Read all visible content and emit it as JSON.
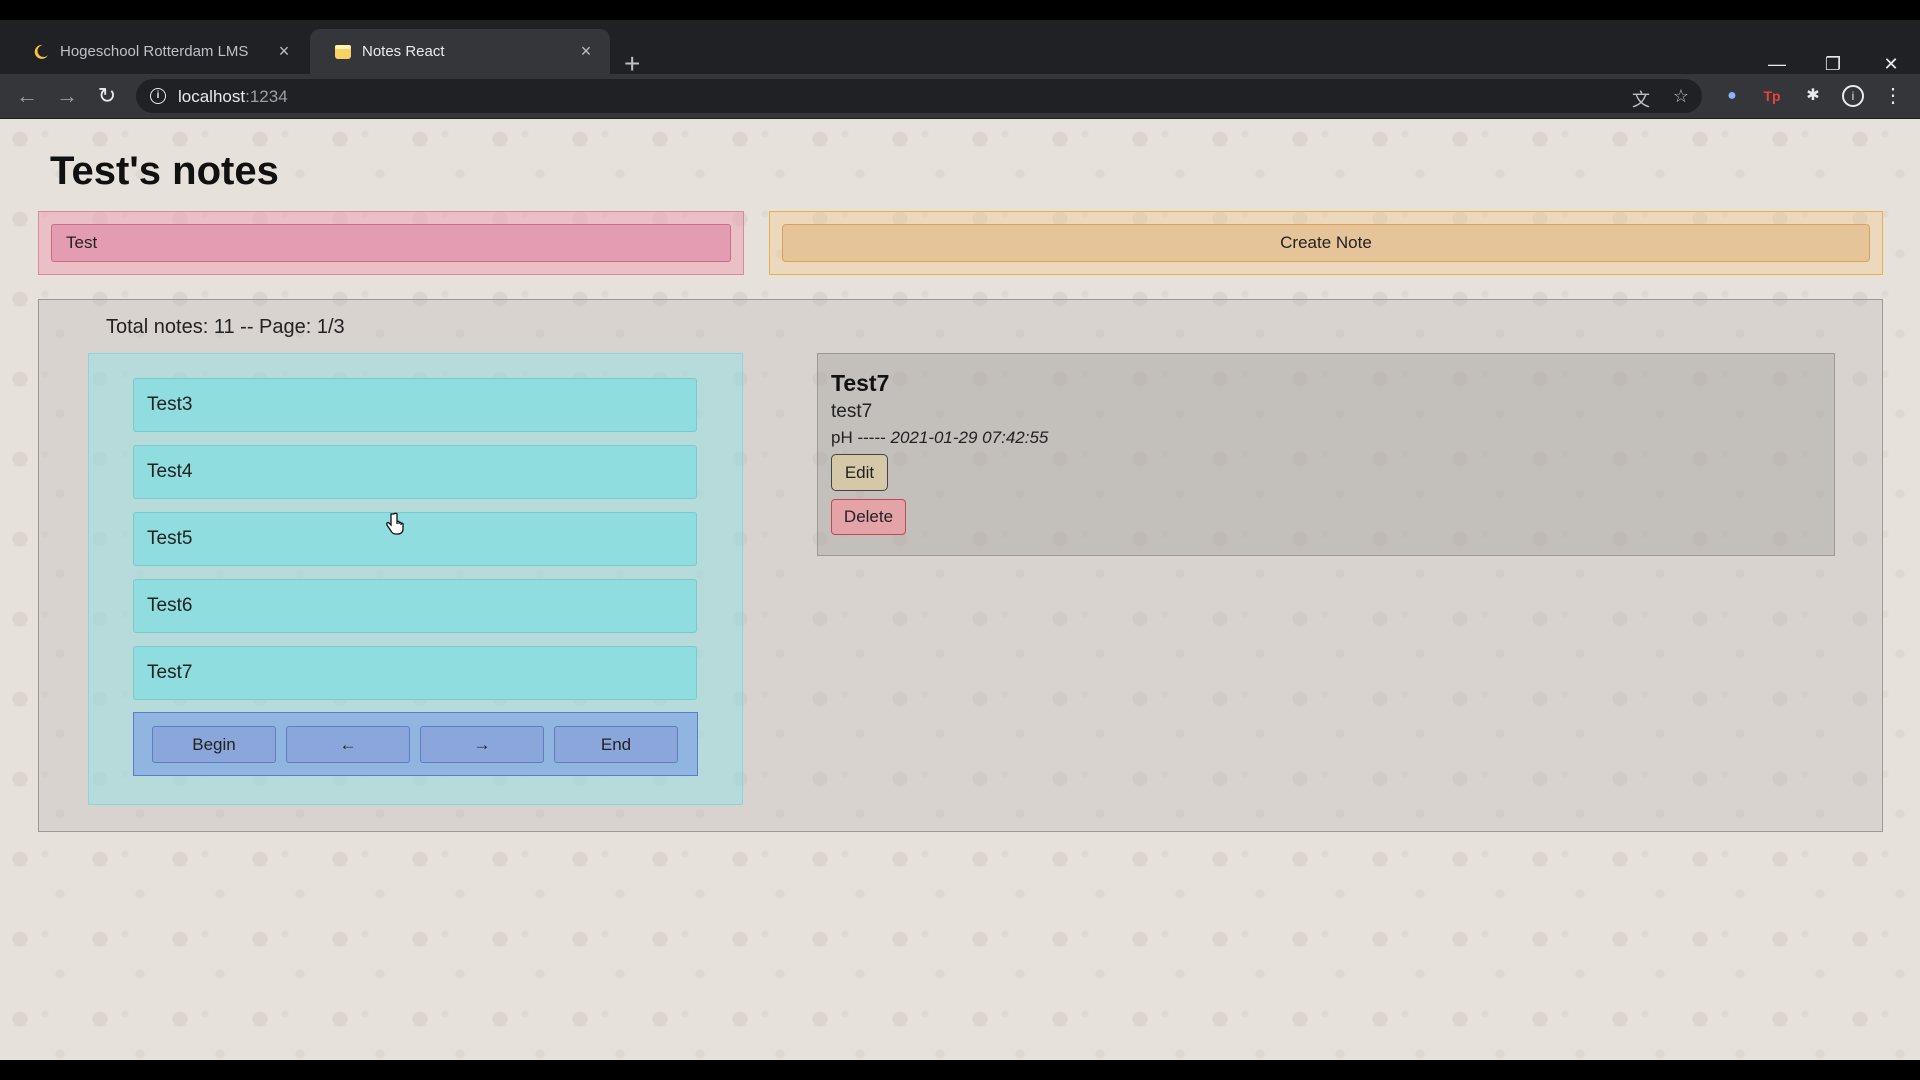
{
  "browser": {
    "tabs": [
      {
        "title": "Hogeschool Rotterdam LMS",
        "active": false,
        "favicon": "moon-favicon-icon"
      },
      {
        "title": "Notes React",
        "active": true,
        "favicon": "notes-favicon-icon"
      }
    ],
    "url_host": "localhost",
    "url_port": ":1234",
    "icons": {
      "back": "←",
      "forward": "→",
      "reload": "↻",
      "new_tab": "+",
      "close_tab": "×",
      "minimize": "—",
      "restore": "❐",
      "close_window": "✕",
      "translate": "⽂",
      "bookmark": "☆",
      "extensions": "✱",
      "menu": "⋮",
      "info": "i",
      "profile": "●",
      "ext_red": "Tp"
    }
  },
  "page": {
    "title": "Test's notes",
    "note_input_value": "Test",
    "create_button_label": "Create Note",
    "total_notes_text": "Total notes: 11 -- Page: 1/3",
    "notes": [
      "Test3",
      "Test4",
      "Test5",
      "Test6",
      "Test7"
    ],
    "pagination": {
      "begin": "Begin",
      "prev": "←",
      "next": "→",
      "end": "End"
    },
    "selected_note": {
      "title": "Test7",
      "body": "test7",
      "author": "pH -----",
      "date": "2021-01-29 07:42:55",
      "edit_label": "Edit",
      "delete_label": "Delete"
    }
  },
  "colors": {
    "input_bg": "#e49cb2",
    "create_bg": "#e6c49a",
    "list_item_bg": "#8fddde",
    "pager_bg": "#8aa6db",
    "delete_bg": "#e3a3a8"
  }
}
